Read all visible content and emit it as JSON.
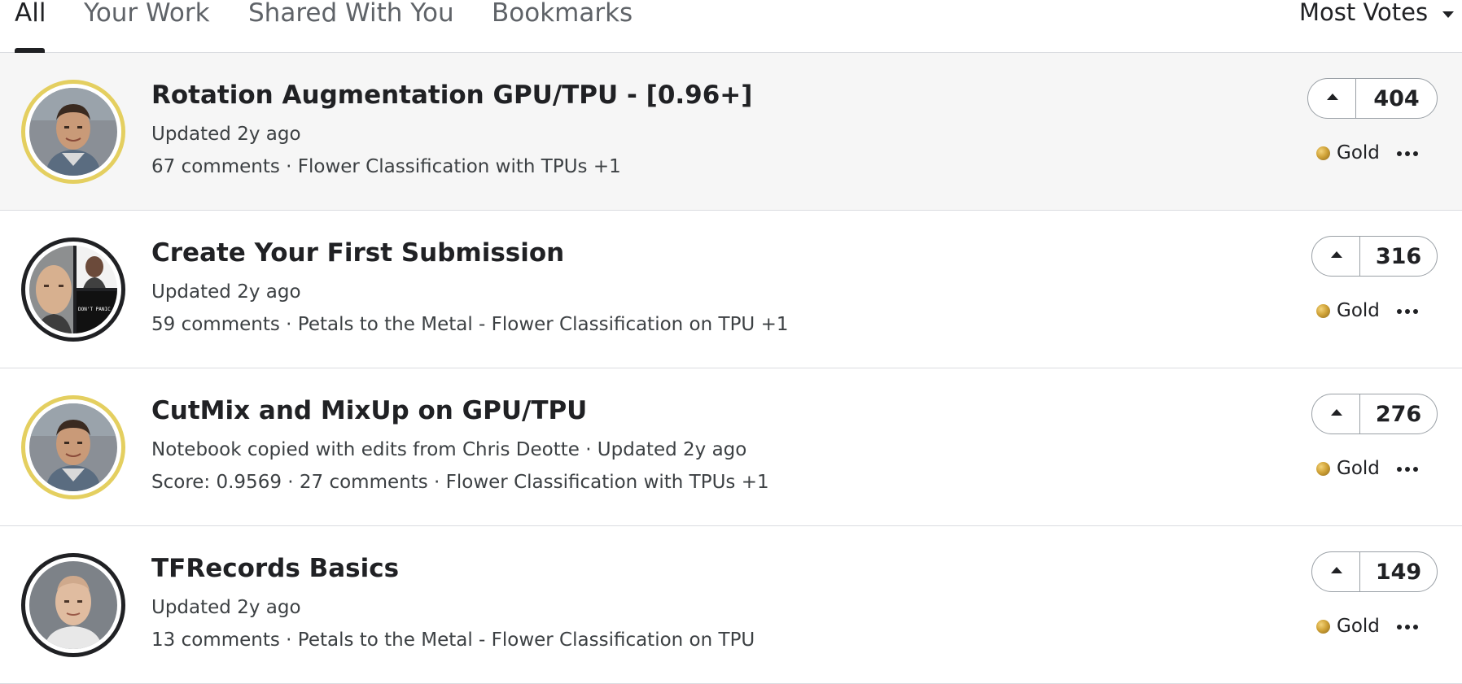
{
  "tabs": [
    {
      "label": "All",
      "active": true
    },
    {
      "label": "Your Work",
      "active": false
    },
    {
      "label": "Shared With You",
      "active": false
    },
    {
      "label": "Bookmarks",
      "active": false
    }
  ],
  "sort": {
    "label": "Most Votes"
  },
  "notebooks": [
    {
      "title": "Rotation Augmentation GPU/TPU - [0.96+]",
      "line1": "Updated 2y ago",
      "line2": "67 comments · Flower Classification with TPUs +1",
      "votes": "404",
      "medal": "Gold"
    },
    {
      "title": "Create Your First Submission",
      "line1": "Updated 2y ago",
      "line2": "59 comments · Petals to the Metal - Flower Classification on TPU +1",
      "votes": "316",
      "medal": "Gold"
    },
    {
      "title": "CutMix and MixUp on GPU/TPU",
      "line1": "Notebook copied with edits from Chris Deotte · Updated 2y ago",
      "line2": "Score: 0.9569 · 27 comments · Flower Classification with TPUs +1",
      "votes": "276",
      "medal": "Gold"
    },
    {
      "title": "TFRecords Basics",
      "line1": "Updated 2y ago",
      "line2": "13 comments · Petals to the Metal - Flower Classification on TPU",
      "votes": "149",
      "medal": "Gold"
    }
  ],
  "colors": {
    "gold_ring": "#e4cf60",
    "medal_gold": "#d0a338",
    "hover_row": "#f6f6f6",
    "text": "#202124"
  }
}
